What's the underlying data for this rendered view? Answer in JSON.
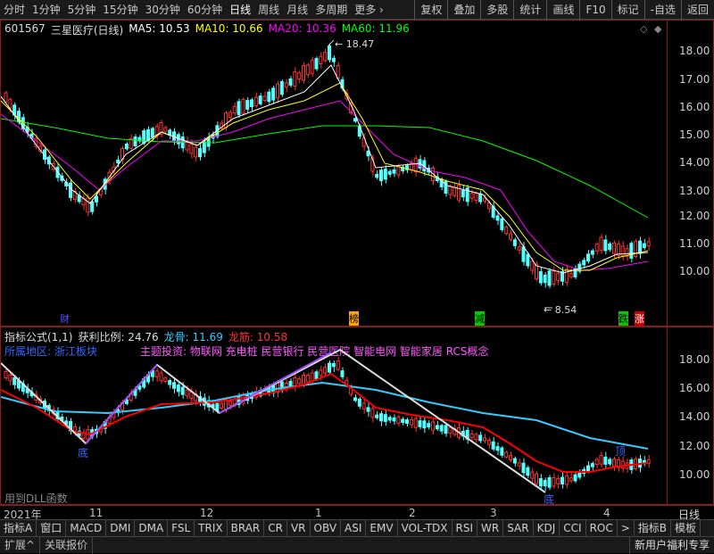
{
  "toolbar": {
    "periods": [
      "分时",
      "1分钟",
      "5分钟",
      "15分钟",
      "30分钟",
      "60分钟",
      "日线",
      "周线",
      "月线",
      "多周期",
      "更多"
    ],
    "active_period": "日线",
    "right_buttons": [
      "复权",
      "叠加",
      "多股",
      "统计",
      "画线",
      "F10",
      "标记",
      "-自选",
      "返回"
    ]
  },
  "main_panel": {
    "stock_code": "601567",
    "stock_name": "三星医疗(日线)",
    "ma5_label": "MA5: 10.53",
    "ma10_label": "MA10: 10.66",
    "ma20_label": "MA20: 10.36",
    "ma60_label": "MA60: 11.96",
    "high_label": "18.47",
    "low_label": "8.54",
    "y_ticks": [
      "18.00",
      "17.00",
      "16.00",
      "15.00",
      "14.00",
      "13.00",
      "12.00",
      "11.00",
      "10.00"
    ],
    "markers": [
      "财",
      "榜",
      "减",
      "跌",
      "涨"
    ]
  },
  "indicator_panel": {
    "title": "指标公式(1,1)",
    "profit_ratio": "获利比例: 24.76",
    "dragon_bone": "龙骨: 11.69",
    "dragon_tendon": "龙筋: 10.58",
    "region_label": "所属地区: 浙江板块",
    "theme_label": "主题投资: 物联网 充电桩 民营银行 民营医院 智能电网 智能家居 RCS概念",
    "bottom_label_1": "底",
    "bottom_label_2": "底",
    "top_label": "顶",
    "dll_note": "用到DLL函数",
    "y_ticks": [
      "18.00",
      "16.00",
      "14.00",
      "12.00",
      "10.00"
    ]
  },
  "x_axis": [
    "2021年",
    "11",
    "12",
    "1",
    "2",
    "3",
    "4"
  ],
  "x_axis_right": "日线",
  "tabs": [
    "指标A",
    "窗口",
    "MACD",
    "DMI",
    "DMA",
    "FSL",
    "TRIX",
    "BRAR",
    "CR",
    "VR",
    "OBV",
    "ASI",
    "EMV",
    "VOL-TDX",
    "RSI",
    "WR",
    "SAR",
    "KDJ",
    "CCI",
    "ROC",
    ">",
    "指标B",
    "模板"
  ],
  "status": {
    "expand": "扩展",
    "related": "关联报价",
    "promo": "新用户福利专享"
  },
  "colors": {
    "up": "#ff3232",
    "down": "#54ffff",
    "ma5": "#ffffff",
    "ma10": "#ffff00",
    "ma20": "#ff00ff",
    "ma60": "#00ff00",
    "dragon_bone": "#33ccff",
    "dragon_tendon": "#ff0000"
  }
}
